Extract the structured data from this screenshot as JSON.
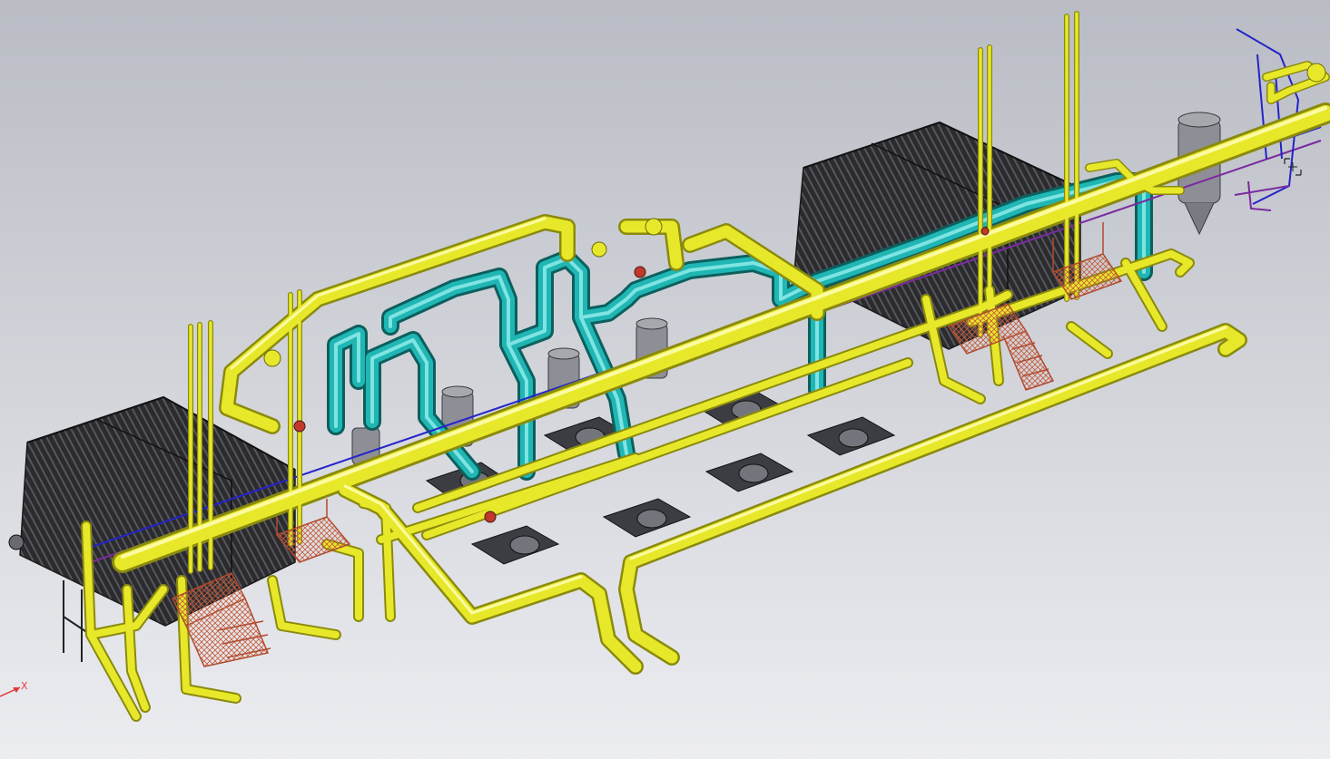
{
  "viewport": {
    "background_top": "#b9bcc4",
    "background_bottom": "#ecedf1"
  },
  "axis": {
    "x_label": "X",
    "color": "#e03b3b"
  },
  "colors": {
    "main_pipe": "#e8e82a",
    "main_pipe_dark": "#8a8a0e",
    "cyan_pipe": "#1fb6b4",
    "cyan_pipe_dark": "#0c5f5d",
    "blue_line": "#2424c8",
    "purple_line": "#7a2aa0",
    "cooler_body": "#2b2b2e",
    "cooler_fin": "#505057",
    "platform": "#d46a4a",
    "tank": "#8e8f96",
    "pump": "#3c3d42"
  },
  "scene": {
    "air_coolers": [
      {
        "name": "air-cooler-left"
      },
      {
        "name": "air-cooler-right"
      }
    ],
    "pump_units": [
      {
        "name": "pump-unit-1"
      },
      {
        "name": "pump-unit-2"
      },
      {
        "name": "pump-unit-3"
      },
      {
        "name": "pump-unit-4"
      },
      {
        "name": "pump-unit-5"
      },
      {
        "name": "pump-unit-6"
      },
      {
        "name": "pump-unit-7"
      }
    ],
    "vessels": [
      {
        "name": "vessel-1"
      },
      {
        "name": "vessel-2"
      },
      {
        "name": "vessel-3"
      },
      {
        "name": "vessel-4"
      },
      {
        "name": "vessel-5"
      }
    ],
    "platforms": [
      {
        "name": "platform-left-1"
      },
      {
        "name": "platform-left-2"
      },
      {
        "name": "platform-right-1"
      },
      {
        "name": "platform-right-2"
      }
    ]
  }
}
